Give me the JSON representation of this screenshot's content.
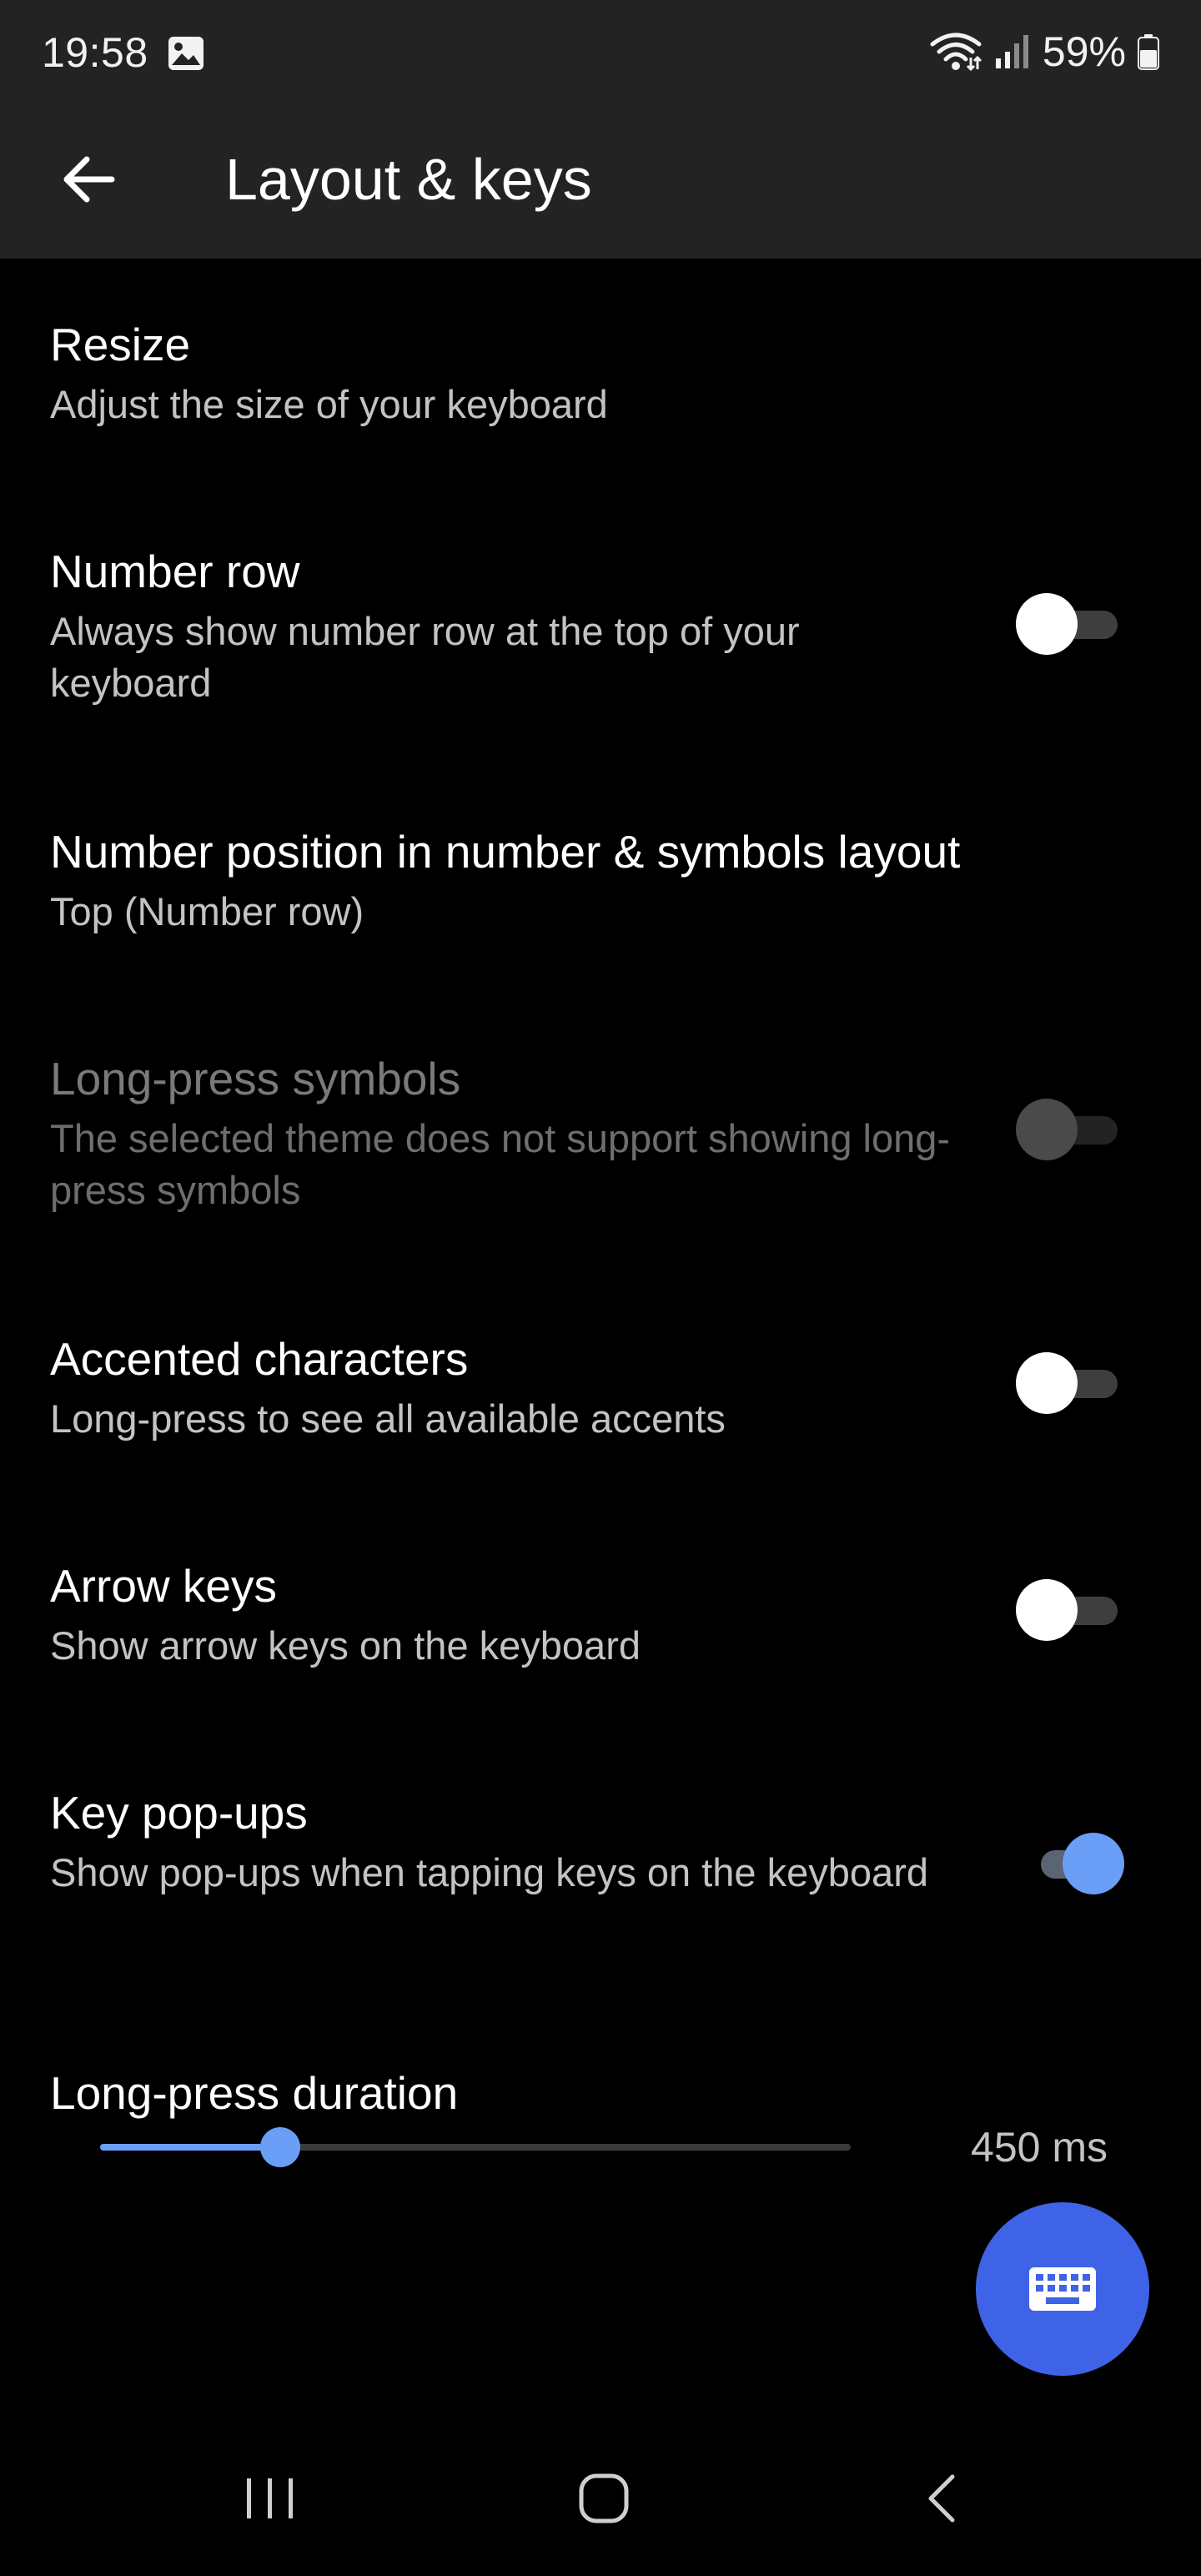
{
  "status_bar": {
    "time": "19:58",
    "battery": "59%",
    "icons": [
      "image-icon",
      "wifi-icon",
      "signal-icon",
      "battery-icon"
    ]
  },
  "app_bar": {
    "title": "Layout & keys",
    "back_icon": "arrow-left-icon"
  },
  "settings": {
    "resize": {
      "title": "Resize",
      "subtitle": "Adjust the size of your keyboard"
    },
    "number_row": {
      "title": "Number row",
      "subtitle": "Always show number row at the top of your keyboard",
      "enabled": false
    },
    "number_position": {
      "title": "Number position in number & symbols layout",
      "subtitle": "Top (Number row)"
    },
    "long_press_symbols": {
      "title": "Long-press symbols",
      "subtitle": "The selected theme does not support showing long-press symbols",
      "enabled": false,
      "disabled": true
    },
    "accented_characters": {
      "title": "Accented characters",
      "subtitle": "Long-press to see all available accents",
      "enabled": false
    },
    "arrow_keys": {
      "title": "Arrow keys",
      "subtitle": "Show arrow keys on the keyboard",
      "enabled": false
    },
    "key_popups": {
      "title": "Key pop-ups",
      "subtitle": "Show pop-ups when tapping keys on the keyboard",
      "enabled": true
    },
    "long_press_duration": {
      "title": "Long-press duration",
      "value_label": "450 ms",
      "slider_fraction": 0.24
    }
  },
  "fab": {
    "icon": "keyboard-icon"
  },
  "nav": {
    "recents_icon": "recents-icon",
    "home_icon": "home-icon",
    "back_icon": "nav-back-icon"
  },
  "colors": {
    "accent": "#6b9ef7",
    "fab": "#3f63e6",
    "app_bar": "#232323",
    "background": "#000000"
  }
}
